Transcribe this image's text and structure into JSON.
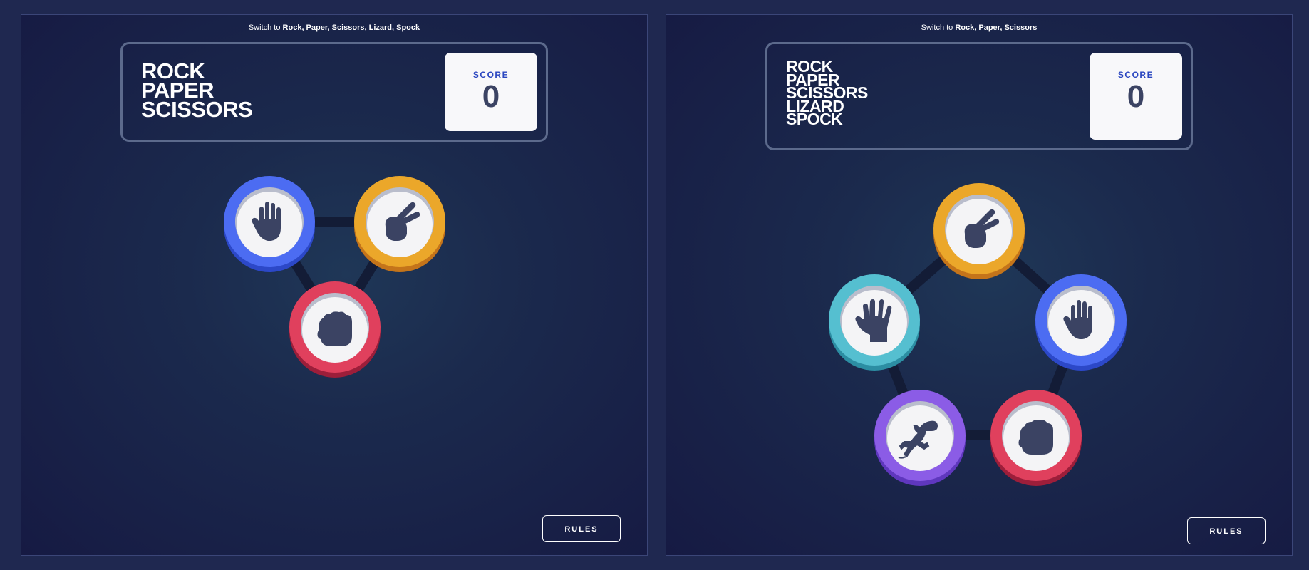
{
  "left": {
    "switch_prefix": "Switch to",
    "switch_link": "Rock, Paper, Scissors, Lizard, Spock",
    "title_lines": [
      "ROCK",
      "PAPER",
      "SCISSORS"
    ],
    "score_label": "SCORE",
    "score_value": "0",
    "rules_label": "RULES",
    "tokens": [
      {
        "name": "paper",
        "icon": "paper-icon",
        "color": "#4c6cf2",
        "shade": "#2c48c8"
      },
      {
        "name": "scissors",
        "icon": "scissors-icon",
        "color": "#eba72a",
        "shade": "#c4741a"
      },
      {
        "name": "rock",
        "icon": "rock-icon",
        "color": "#e0405d",
        "shade": "#9c1e3a"
      }
    ]
  },
  "right": {
    "switch_prefix": "Switch to",
    "switch_link": "Rock, Paper, Scissors",
    "title_lines": [
      "ROCK",
      "PAPER",
      "SCISSORS",
      "LIZARD",
      "SPOCK"
    ],
    "score_label": "SCORE",
    "score_value": "0",
    "rules_label": "RULES",
    "tokens": [
      {
        "name": "scissors",
        "icon": "scissors-icon",
        "color": "#eba72a",
        "shade": "#c4741a"
      },
      {
        "name": "spock",
        "icon": "spock-icon",
        "color": "#55bfd0",
        "shade": "#2c8ea3"
      },
      {
        "name": "paper",
        "icon": "paper-icon",
        "color": "#4c6cf2",
        "shade": "#2c48c8"
      },
      {
        "name": "lizard",
        "icon": "lizard-icon",
        "color": "#8b5ce6",
        "shade": "#5f37be"
      },
      {
        "name": "rock",
        "icon": "rock-icon",
        "color": "#e0405d",
        "shade": "#9c1e3a"
      }
    ]
  }
}
